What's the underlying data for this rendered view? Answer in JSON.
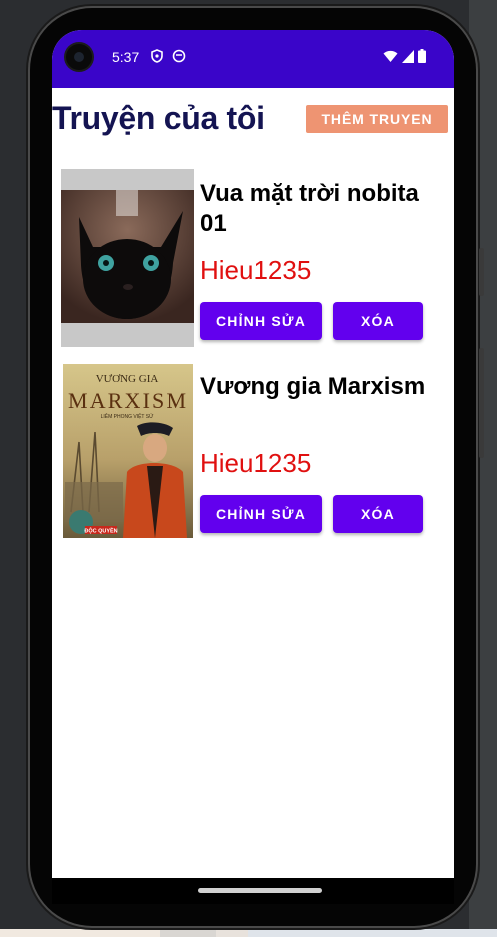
{
  "status_bar": {
    "time": "5:37",
    "icons": [
      "shield-icon",
      "face-icon",
      "wifi-icon",
      "signal-icon",
      "battery-icon"
    ]
  },
  "header": {
    "title": "Truyện của tôi",
    "add_button": "THÊM TRUYEN"
  },
  "stories": [
    {
      "title": " Vua mặt trời nobita 01",
      "author": "Hieu1235",
      "edit_label": "CHỈNH SỬA",
      "delete_label": "XÓA",
      "cover": {
        "kind": "cat-photo"
      }
    },
    {
      "title": "Vương gia Marxism",
      "author": "Hieu1235",
      "edit_label": "CHỈNH SỬA",
      "delete_label": "XÓA",
      "cover": {
        "kind": "book-cover",
        "line1": "VƯƠNG GIA",
        "line2": "MARXISM",
        "line3": "LIÊM PHONG VIỆT SỬ",
        "badge": "ĐỘC QUYỀN"
      }
    }
  ],
  "colors": {
    "status_bar": "#3a05c9",
    "button": "#6200ee",
    "add_button": "#ee9472",
    "author": "#e01010",
    "title": "#141452"
  }
}
